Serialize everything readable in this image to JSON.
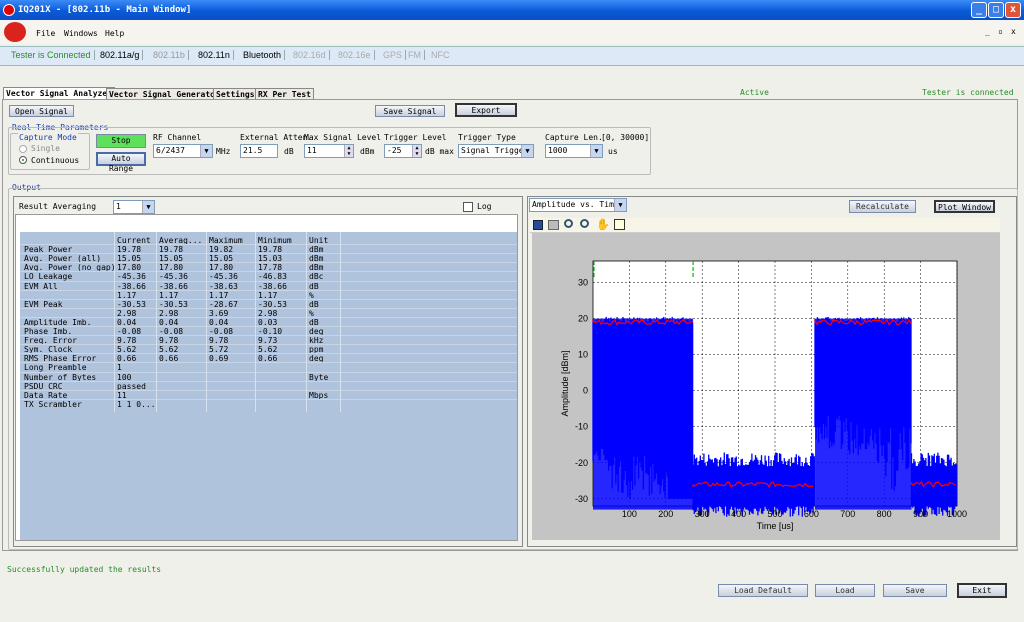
{
  "window": {
    "title": "IQ201X - [802.11b - Main Window]",
    "minimize": "_",
    "maximize": "□",
    "close": "x",
    "menu_min": "_",
    "menu_restore": "▫",
    "menu_close": "x"
  },
  "menu": [
    "File",
    "Windows",
    "Help"
  ],
  "status_strip": [
    "Tester is Connected",
    "802.11a/g",
    "802.11b",
    "802.11n",
    "Bluetooth",
    "802.16d",
    "802.16e",
    "GPS",
    "FM",
    "NFC"
  ],
  "tabs": [
    "Vector Signal Analyzer",
    "Vector Signal Generator",
    "Settings",
    "RX Per Test"
  ],
  "status": {
    "active": "Active",
    "connected": "Tester is connected"
  },
  "toolbar": {
    "open_signal": "Open Signal",
    "save_signal": "Save Signal",
    "export": "Export"
  },
  "rtp": {
    "title": "Real Time Parameters",
    "capture_mode": "Capture Mode",
    "single": "Single",
    "continuous": "Continuous",
    "stop": "Stop",
    "auto_range": "Auto Range",
    "rf_channel_label": "RF Channel",
    "rf_channel": "6/2437",
    "mhz": "MHz",
    "ext_atten_label": "External Atten.",
    "ext_atten": "21.5",
    "db": "dB",
    "max_level_label": "Max Signal Level",
    "max_level": "11",
    "dbm": "dBm",
    "trigger_level_label": "Trigger Level",
    "trigger_level": "-25",
    "db_max": "dB max",
    "trigger_type_label": "Trigger Type",
    "trigger_type": "Signal Trigger",
    "capture_len_label": "Capture Len.",
    "capture_range": "[0, 30000]",
    "capture_len": "1000",
    "us": "us"
  },
  "output": {
    "title": "Output",
    "result_avg_label": "Result Averaging",
    "result_avg": "1",
    "log": "Log"
  },
  "results": {
    "headers": [
      "",
      "Current",
      "Averag...",
      "Maximum",
      "Minimum",
      "Unit"
    ],
    "rows": [
      [
        "Peak Power",
        "19.78",
        "19.78",
        "19.82",
        "19.78",
        "dBm"
      ],
      [
        "Avg. Power (all)",
        "15.05",
        "15.05",
        "15.05",
        "15.03",
        "dBm"
      ],
      [
        "Avg. Power (no gap)",
        "17.80",
        "17.80",
        "17.80",
        "17.78",
        "dBm"
      ],
      [
        "LO Leakage",
        "-45.36",
        "-45.36",
        "-45.36",
        "-46.83",
        "dBc"
      ],
      [
        "EVM All",
        "-38.66",
        "-38.66",
        "-38.63",
        "-38.66",
        "dB"
      ],
      [
        "",
        "1.17",
        "1.17",
        "1.17",
        "1.17",
        "%"
      ],
      [
        "EVM Peak",
        "-30.53",
        "-30.53",
        "-28.67",
        "-30.53",
        "dB"
      ],
      [
        "",
        "2.98",
        "2.98",
        "3.69",
        "2.98",
        "%"
      ],
      [
        "Amplitude Imb.",
        "0.04",
        "0.04",
        "0.04",
        "0.03",
        "dB"
      ],
      [
        "Phase Imb.",
        "-0.08",
        "-0.08",
        "-0.08",
        "-0.10",
        "deg"
      ],
      [
        "Freq. Error",
        "9.78",
        "9.78",
        "9.78",
        "9.73",
        "kHz"
      ],
      [
        "Sym. Clock",
        "5.62",
        "5.62",
        "5.72",
        "5.62",
        "ppm"
      ],
      [
        "RMS Phase Error",
        "0.66",
        "0.66",
        "0.69",
        "0.66",
        "deg"
      ],
      [
        "Long Preamble",
        "1",
        "",
        "",
        "",
        ""
      ],
      [
        "Number of Bytes",
        "100",
        "",
        "",
        "",
        "Byte"
      ],
      [
        "PSDU CRC",
        "passed",
        "",
        "",
        "",
        ""
      ],
      [
        "Data Rate",
        "11",
        "",
        "",
        "",
        "Mbps"
      ],
      [
        "TX Scrambler",
        "1 1 0...",
        "",
        "",
        "",
        ""
      ]
    ]
  },
  "plot": {
    "mode": "Amplitude vs. Time",
    "recalculate": "Recalculate",
    "plot_window": "Plot Window"
  },
  "chart_data": {
    "type": "line",
    "xlabel": "Time [us]",
    "ylabel": "Amplitude [dBm]",
    "xlim": [
      0,
      1000
    ],
    "ylim": [
      -32,
      36
    ],
    "x_ticks": [
      "100",
      "200",
      "300",
      "400",
      "500",
      "600",
      "700",
      "800",
      "900",
      "1000"
    ],
    "y_ticks": [
      "30",
      "20",
      "10",
      "0",
      "-10",
      "-20",
      "-30"
    ],
    "grid": true,
    "segments": [
      {
        "x0": 0,
        "x1": 275,
        "level": 19
      },
      {
        "x0": 275,
        "x1": 610,
        "level": -26
      },
      {
        "x0": 610,
        "x1": 875,
        "level": 19
      },
      {
        "x0": 875,
        "x1": 1000,
        "level": -26
      }
    ],
    "colors": {
      "signal": "#0000ff",
      "envelope": "#ff0000",
      "trigger": "#00c000"
    }
  },
  "footer": {
    "message": "Successfully updated the results",
    "load_default": "Load Default",
    "load": "Load",
    "save": "Save",
    "exit": "Exit"
  }
}
